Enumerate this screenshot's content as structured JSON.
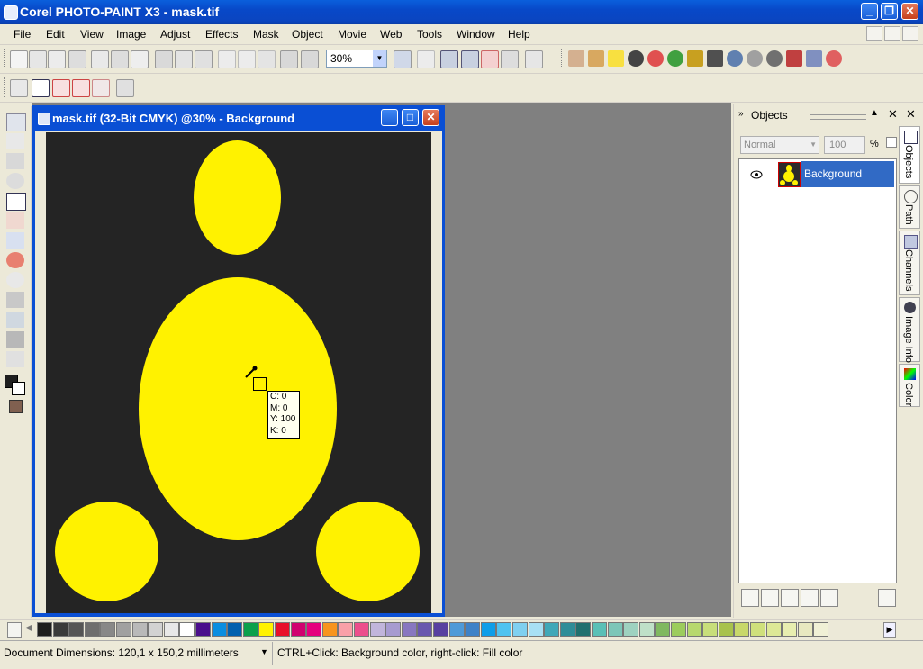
{
  "window": {
    "title": "Corel PHOTO-PAINT X3 - mask.tif",
    "minimize": "_",
    "maximize": "❐",
    "close": "✕"
  },
  "menu": [
    "File",
    "Edit",
    "View",
    "Image",
    "Adjust",
    "Effects",
    "Mask",
    "Object",
    "Movie",
    "Web",
    "Tools",
    "Window",
    "Help"
  ],
  "toolbar": {
    "zoom_value": "30%"
  },
  "document": {
    "title": "mask.tif (32-Bit CMYK) @30% - Background",
    "shape_color": "#fff200",
    "background_color": "#242424"
  },
  "tooltip": {
    "c": "C: 0",
    "m": "M: 0",
    "y": "Y: 100",
    "k": "K: 0"
  },
  "objects_docker": {
    "title": "Objects",
    "blend_mode": "Normal",
    "opacity": "100",
    "percent": "%",
    "layer_name": "Background"
  },
  "docker_tabs": [
    "Objects",
    "Path",
    "Channels",
    "Image Info",
    "Color"
  ],
  "palette": [
    "#1e1e1e",
    "#3a3a3a",
    "#555555",
    "#6e6e6e",
    "#888888",
    "#a0a0a0",
    "#b9b9b9",
    "#d2d2d2",
    "#e8e8e8",
    "#ffffff",
    "#4b0f8c",
    "#0a8ee0",
    "#0060ae",
    "#0ca04a",
    "#fff200",
    "#e8102a",
    "#d0006f",
    "#e5007e",
    "#f7941d",
    "#f9a0a8",
    "#ec4e8c",
    "#c1b5db",
    "#a79bd0",
    "#8877c0",
    "#6957ae",
    "#5840a0",
    "#4e9ad8",
    "#3e82c7",
    "#0e9ee8",
    "#4fc3f0",
    "#7fd0f0",
    "#a8e0f4",
    "#40a8b8",
    "#2e8d98",
    "#20706f",
    "#5ac0b6",
    "#7cc6b8",
    "#9ed2c0",
    "#bfe0c8",
    "#80b860",
    "#9ccc5c",
    "#b7d86e",
    "#c8de7a",
    "#a8c24c",
    "#c8d86a",
    "#cfe07c",
    "#dde896",
    "#e8eeb0",
    "#e8e8c0",
    "#f0f0d6"
  ],
  "status": {
    "dimensions": "Document Dimensions: 120,1 x 150,2 millimeters",
    "hint": "CTRL+Click: Background color, right-click: Fill color"
  }
}
